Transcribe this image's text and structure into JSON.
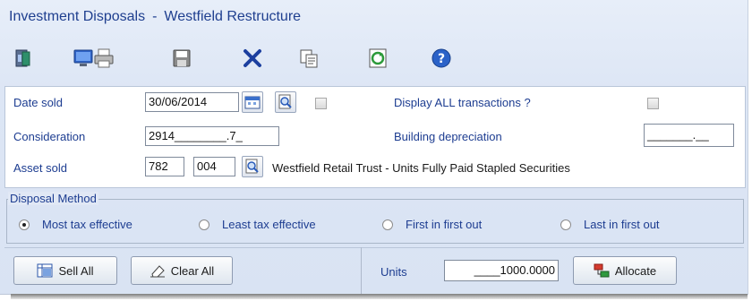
{
  "window": {
    "title": "Investment Disposals",
    "separator": "-",
    "subtitle": "Westfield Restructure"
  },
  "toolbar": {
    "buttons": [
      {
        "icon": "exit-icon"
      },
      {
        "icon": "monitor-icon"
      },
      {
        "icon": "print-icon"
      },
      {
        "icon": "save-icon"
      },
      {
        "icon": "delete-icon"
      },
      {
        "icon": "copy-icon"
      },
      {
        "icon": "refresh-icon"
      },
      {
        "icon": "help-icon"
      }
    ]
  },
  "form": {
    "date_sold": {
      "label": "Date sold",
      "value": "30/06/2014"
    },
    "display_all": {
      "label": "Display ALL transactions ?",
      "checked": false
    },
    "consideration": {
      "label": "Consideration",
      "value": "2914________.7_"
    },
    "building_depreciation": {
      "label": "Building depreciation",
      "value": "_______.__"
    },
    "asset_sold": {
      "label": "Asset sold",
      "code1": "782",
      "code2": "004",
      "description": "Westfield Retail Trust - Units Fully Paid Stapled Securities"
    }
  },
  "disposal_method": {
    "title": "Disposal Method",
    "options": [
      {
        "label": "Most tax effective",
        "selected": true
      },
      {
        "label": "Least tax effective",
        "selected": false
      },
      {
        "label": "First in first out",
        "selected": false
      },
      {
        "label": "Last in first out",
        "selected": false
      }
    ]
  },
  "actions": {
    "sell_all": "Sell All",
    "clear_all": "Clear All",
    "units_label": "Units",
    "units_value": "____1000.0000",
    "allocate": "Allocate"
  },
  "colors": {
    "label": "#1d3d91",
    "title": "#1f3f8f",
    "background": "#dde6f5"
  }
}
